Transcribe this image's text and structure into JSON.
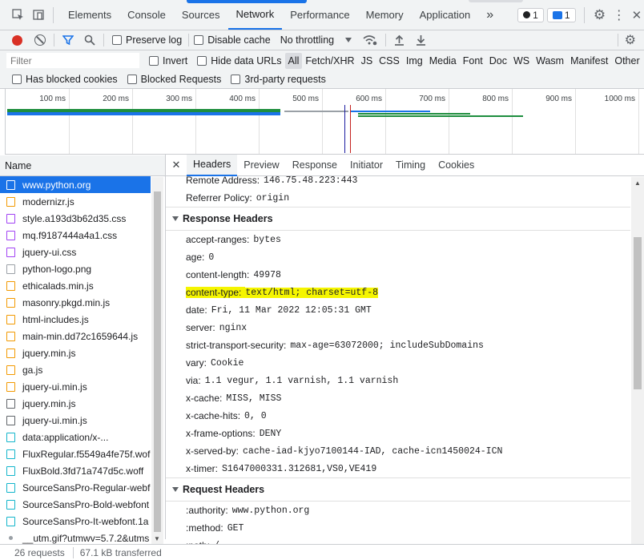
{
  "top_tabs": {
    "items": [
      "Elements",
      "Console",
      "Sources",
      "Network",
      "Performance",
      "Memory",
      "Application"
    ],
    "active": "Network",
    "more": "»",
    "errors_count": "1",
    "messages_count": "1"
  },
  "toolbar": {
    "preserve_log": "Preserve log",
    "disable_cache": "Disable cache",
    "throttling": "No throttling"
  },
  "filter": {
    "placeholder": "Filter",
    "invert": "Invert",
    "hide_data_urls": "Hide data URLs",
    "types": [
      "All",
      "Fetch/XHR",
      "JS",
      "CSS",
      "Img",
      "Media",
      "Font",
      "Doc",
      "WS",
      "Wasm",
      "Manifest",
      "Other"
    ],
    "has_blocked_cookies": "Has blocked cookies",
    "blocked_requests": "Blocked Requests",
    "third_party": "3rd-party requests"
  },
  "timeline": {
    "ticks": [
      "100 ms",
      "200 ms",
      "300 ms",
      "400 ms",
      "500 ms",
      "600 ms",
      "700 ms",
      "800 ms",
      "900 ms",
      "1000 ms"
    ]
  },
  "requests": {
    "header": "Name",
    "items": [
      {
        "name": "www.python.org",
        "kind": "doc"
      },
      {
        "name": "modernizr.js",
        "kind": "js"
      },
      {
        "name": "style.a193d3b62d35.css",
        "kind": "css"
      },
      {
        "name": "mq.f9187444a4a1.css",
        "kind": "css"
      },
      {
        "name": "jquery-ui.css",
        "kind": "css"
      },
      {
        "name": "python-logo.png",
        "kind": "img"
      },
      {
        "name": "ethicalads.min.js",
        "kind": "js"
      },
      {
        "name": "masonry.pkgd.min.js",
        "kind": "js"
      },
      {
        "name": "html-includes.js",
        "kind": "js"
      },
      {
        "name": "main-min.dd72c1659644.js",
        "kind": "js"
      },
      {
        "name": "jquery.min.js",
        "kind": "js"
      },
      {
        "name": "ga.js",
        "kind": "js"
      },
      {
        "name": "jquery-ui.min.js",
        "kind": "js"
      },
      {
        "name": "jquery.min.js",
        "kind": "blank"
      },
      {
        "name": "jquery-ui.min.js",
        "kind": "blank"
      },
      {
        "name": "data:application/x-...",
        "kind": "font"
      },
      {
        "name": "FluxRegular.f5549a4fe75f.wof",
        "kind": "font"
      },
      {
        "name": "FluxBold.3fd71a747d5c.woff",
        "kind": "font"
      },
      {
        "name": "SourceSansPro-Regular-webf",
        "kind": "font"
      },
      {
        "name": "SourceSansPro-Bold-webfont",
        "kind": "font"
      },
      {
        "name": "SourceSansPro-It-webfont.1a",
        "kind": "font"
      },
      {
        "name": "__utm.gif?utmwv=5.7.2&utms",
        "kind": "dot"
      }
    ],
    "status_requests": "26 requests",
    "status_transferred": "67.1 kB transferred"
  },
  "detail_tabs": {
    "items": [
      "Headers",
      "Preview",
      "Response",
      "Initiator",
      "Timing",
      "Cookies"
    ],
    "active": "Headers"
  },
  "general": [
    {
      "k": "Remote Address:",
      "v": "146.75.48.223:443"
    },
    {
      "k": "Referrer Policy:",
      "v": "origin"
    }
  ],
  "response_headers": {
    "title": "Response Headers",
    "items": [
      {
        "k": "accept-ranges:",
        "v": "bytes"
      },
      {
        "k": "age:",
        "v": "0"
      },
      {
        "k": "content-length:",
        "v": "49978"
      },
      {
        "k": "content-type:",
        "v": "text/html; charset=utf-8",
        "highlight": true
      },
      {
        "k": "date:",
        "v": "Fri, 11 Mar 2022 12:05:31 GMT"
      },
      {
        "k": "server:",
        "v": "nginx"
      },
      {
        "k": "strict-transport-security:",
        "v": "max-age=63072000; includeSubDomains"
      },
      {
        "k": "vary:",
        "v": "Cookie"
      },
      {
        "k": "via:",
        "v": "1.1 vegur, 1.1 varnish, 1.1 varnish"
      },
      {
        "k": "x-cache:",
        "v": "MISS, MISS"
      },
      {
        "k": "x-cache-hits:",
        "v": "0, 0"
      },
      {
        "k": "x-frame-options:",
        "v": "DENY"
      },
      {
        "k": "x-served-by:",
        "v": "cache-iad-kjyo7100144-IAD, cache-icn1450024-ICN"
      },
      {
        "k": "x-timer:",
        "v": "S1647000331.312681,VS0,VE419"
      }
    ]
  },
  "request_headers": {
    "title": "Request Headers",
    "items": [
      {
        "k": ":authority:",
        "v": "www.python.org"
      },
      {
        "k": ":method:",
        "v": "GET"
      },
      {
        "k": ":path:",
        "v": "/"
      }
    ]
  },
  "colors": {
    "accent": "#1a73e8",
    "record": "#d93025",
    "highlight": "#f5f500"
  }
}
